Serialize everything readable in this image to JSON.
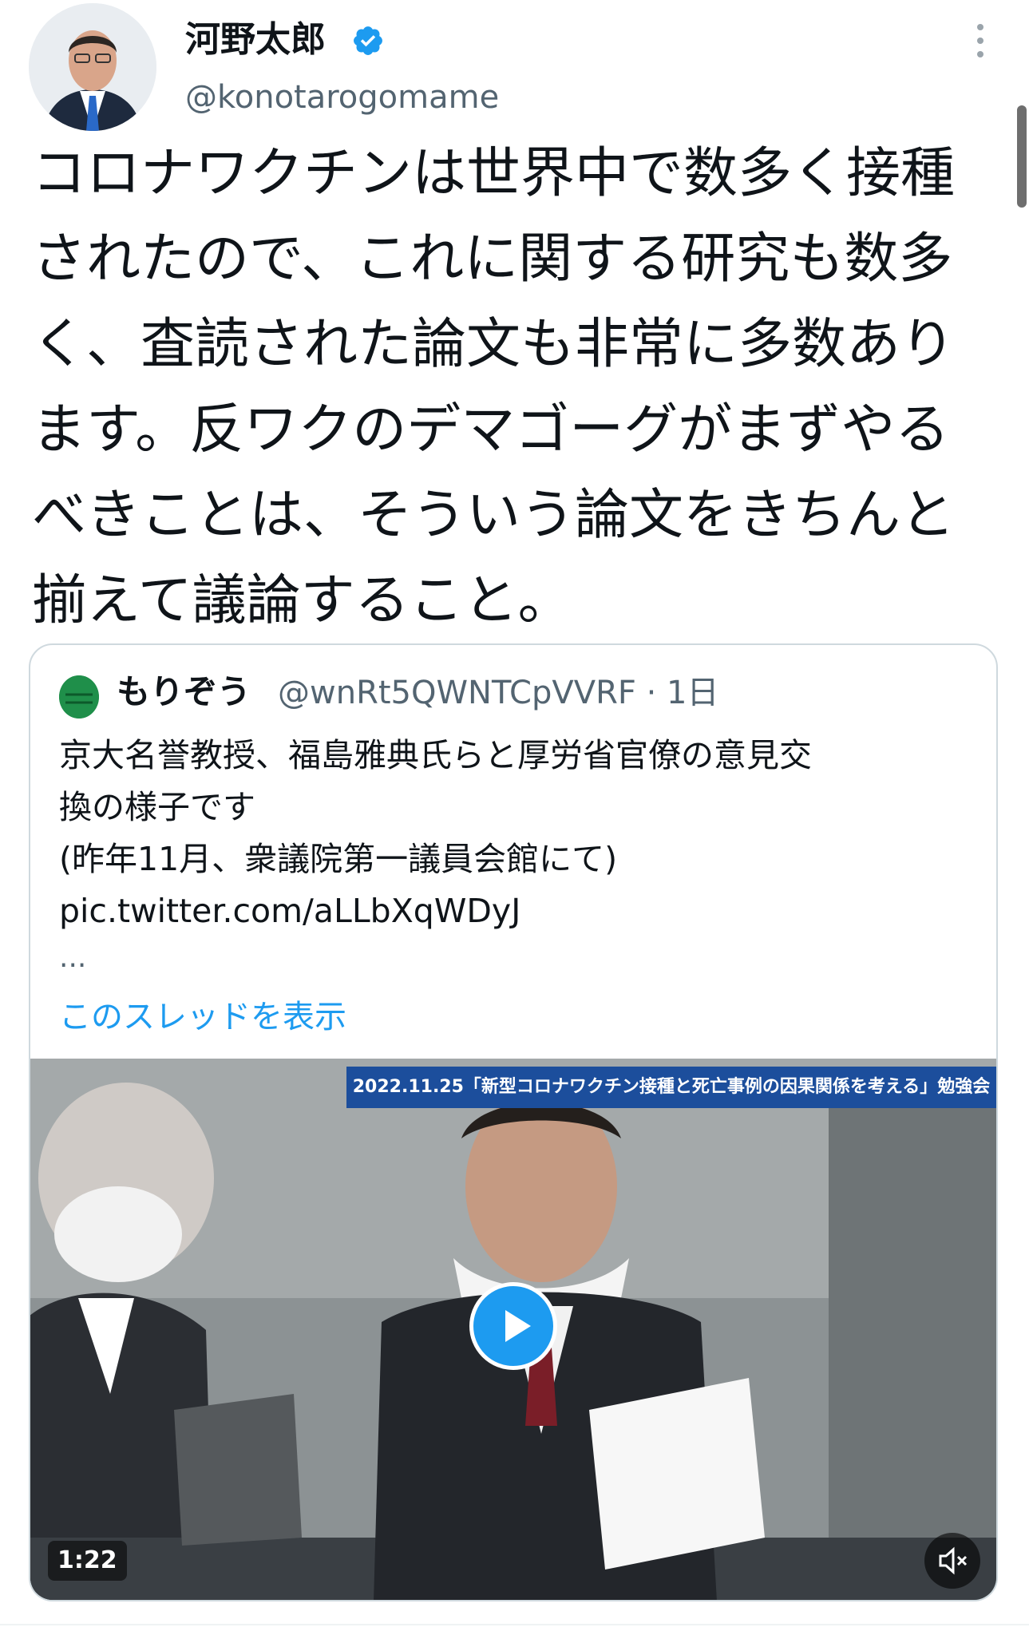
{
  "author": {
    "display_name": "河野太郎",
    "handle": "@konotarogomame",
    "verified_icon": "verified-badge-icon"
  },
  "tweet": {
    "text": "コロナワクチンは世界中で数多く接種\nされたので、これに関する研究も数多\nく、査読された論文も非常に多数あり\nます。反ワクのデマゴーグがまずやる\nべきことは、そういう論文をきちんと\n揃えて議論すること。"
  },
  "quoted": {
    "display_name": "もりぞう",
    "handle_time": "@wnRt5QWNTCpVVRF · 1日",
    "text": "京大名誉教授、福島雅典氏らと厚労省官僚の意見交\n換の様子です\n(昨年11月、衆議院第一議員会館にて)\npic.twitter.com/aLLbXqWDyJ",
    "ellipsis": "...",
    "show_thread": "このスレッドを表示",
    "video": {
      "banner": "2022.11.25「新型コロナワクチン接種と死亡事例の因果関係を考える」勉強会",
      "duration": "1:22",
      "play_icon": "play-icon",
      "mute_icon": "mute-icon"
    }
  },
  "colors": {
    "link": "#1d9bf0",
    "secondary_text": "#536471",
    "verified": "#1d9bf0",
    "banner": "#1c4e9c"
  }
}
